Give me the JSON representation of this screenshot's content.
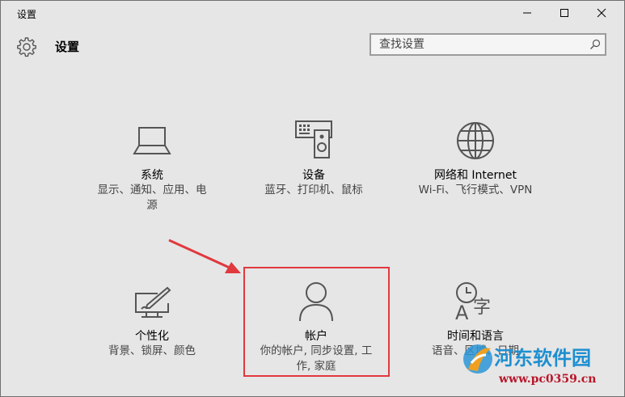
{
  "window": {
    "title": "设置"
  },
  "header": {
    "title": "设置"
  },
  "search": {
    "placeholder": "查找设置"
  },
  "tiles": [
    {
      "name": "系统",
      "desc_line1": "显示、通知、应用、电",
      "desc_line2": "源",
      "icon": "laptop-icon"
    },
    {
      "name": "设备",
      "desc_line1": "蓝牙、打印机、鼠标",
      "desc_line2": "",
      "icon": "devices-icon"
    },
    {
      "name": "网络和 Internet",
      "desc_line1": "Wi-Fi、飞行模式、VPN",
      "desc_line2": "",
      "icon": "globe-icon"
    },
    {
      "name": "个性化",
      "desc_line1": "背景、锁屏、颜色",
      "desc_line2": "",
      "icon": "paint-icon"
    },
    {
      "name": "帐户",
      "desc_line1": "你的帐户, 同步设置, 工",
      "desc_line2": "作, 家庭",
      "icon": "person-icon"
    },
    {
      "name": "时间和语言",
      "desc_line1": "语音、区域、日期",
      "desc_line2": "",
      "icon": "time-language-icon"
    }
  ],
  "watermark": {
    "text": "河东软件园",
    "url": "www.pc0359.cn"
  },
  "colors": {
    "highlight": "#e0393e",
    "background": "#e6e6e6",
    "icon": "#555555"
  }
}
